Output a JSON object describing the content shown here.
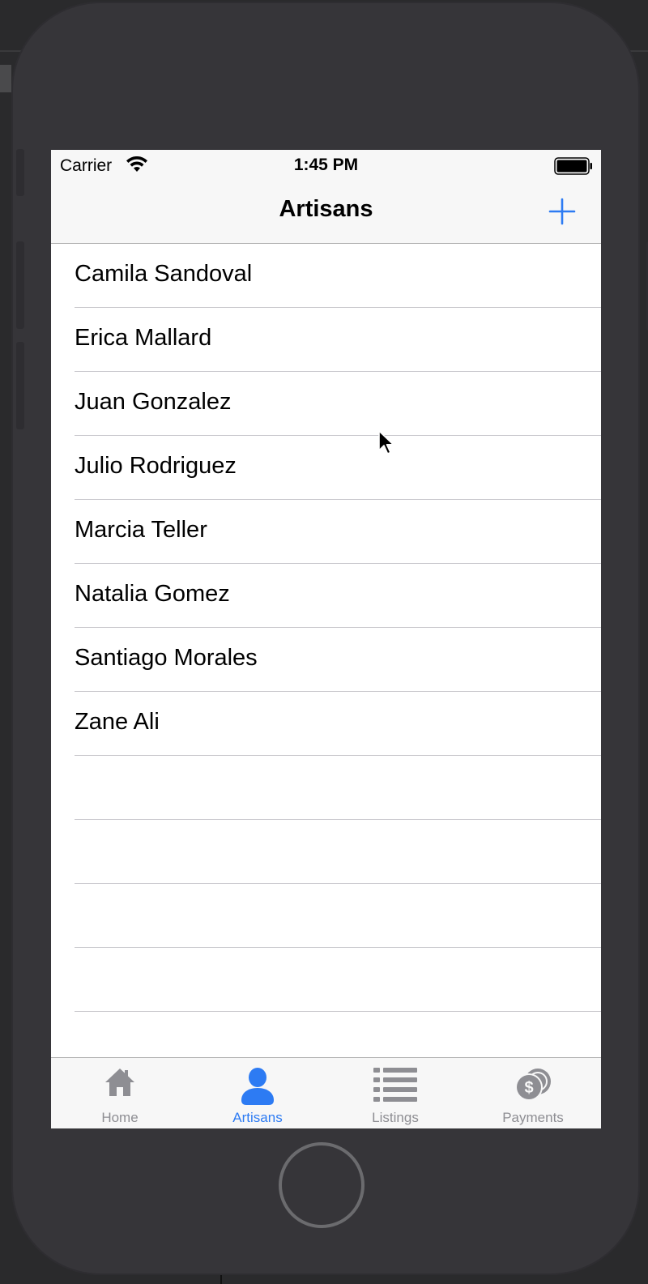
{
  "status_bar": {
    "carrier": "Carrier",
    "time": "1:45 PM"
  },
  "nav": {
    "title": "Artisans",
    "add_icon": "plus-icon"
  },
  "artisans": [
    "Camila Sandoval",
    "Erica Mallard",
    "Juan Gonzalez",
    "Julio Rodriguez",
    "Marcia Teller",
    "Natalia Gomez",
    "Santiago Morales",
    "Zane Ali"
  ],
  "tabs": [
    {
      "label": "Home",
      "icon": "house-icon",
      "active": false
    },
    {
      "label": "Artisans",
      "icon": "person-icon",
      "active": true
    },
    {
      "label": "Listings",
      "icon": "list-icon",
      "active": false
    },
    {
      "label": "Payments",
      "icon": "coins-icon",
      "active": false
    }
  ],
  "colors": {
    "accent": "#2d7bf3",
    "inactive": "#8e8e93",
    "bar": "#f7f7f7",
    "device": "#363539"
  }
}
